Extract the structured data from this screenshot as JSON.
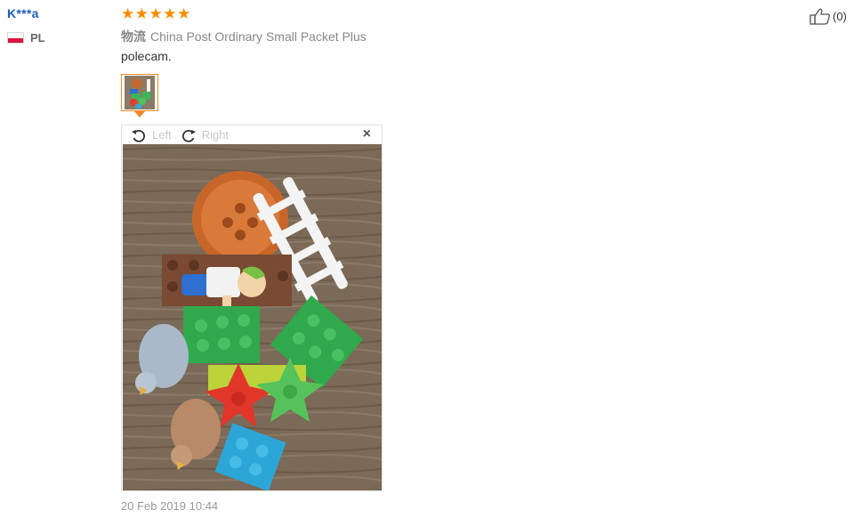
{
  "review": {
    "user_name": "K***a",
    "country_code": "PL",
    "rating": 5,
    "stars": [
      "★",
      "★",
      "★",
      "★",
      "★"
    ],
    "shipping_label": "物流",
    "shipping_method": "China Post Ordinary Small Packet Plus",
    "comment": "polecam.",
    "date": "20 Feb 2019 10:44",
    "helpful_count": "(0)"
  },
  "viewer": {
    "rotate_left_label": "Left",
    "rotate_right_label": "Right",
    "close_symbol": "×"
  },
  "icons": {
    "thumbs_up": "thumbs-up-icon",
    "rotate_left": "rotate-left-icon",
    "rotate_right": "rotate-right-icon",
    "close": "close-icon",
    "flag": "flag-pl-icon"
  },
  "colors": {
    "accent": "#ff8a00",
    "user_link": "#1f5fbf",
    "thumb_border": "#f08a24"
  }
}
